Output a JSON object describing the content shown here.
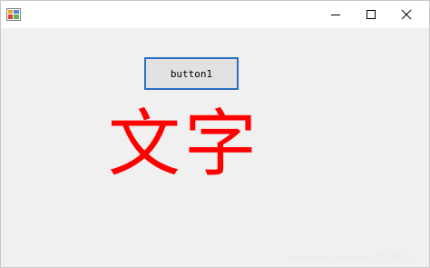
{
  "window": {
    "button1_label": "button1",
    "display_text": "文字",
    "watermark": "https://blog.csdn.net/qq_35280519"
  },
  "icons": {
    "app": "winforms-app-icon",
    "minimize": "minimize-icon",
    "maximize": "maximize-icon",
    "close": "close-icon"
  },
  "colors": {
    "client_background": "#f0f0f0",
    "titlebar_background": "#ffffff",
    "display_text": "#ff0000",
    "button_border": "#2a6ebf",
    "button_face": "#e1e1e1"
  }
}
